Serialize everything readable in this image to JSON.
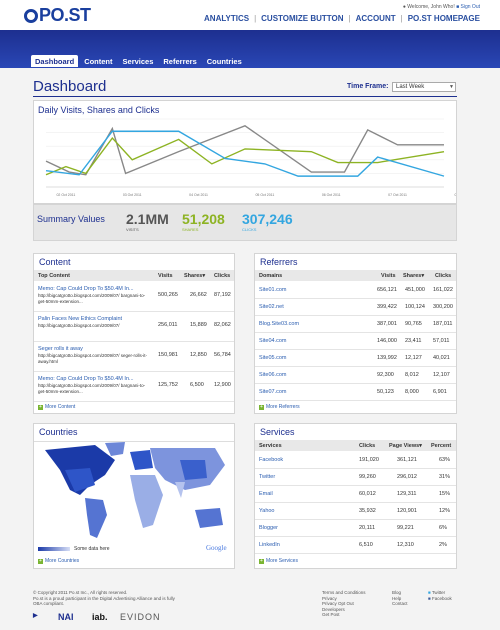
{
  "header": {
    "logo_text": "PO.ST",
    "welcome": "Welcome, John Who!",
    "signout": "Sign Out",
    "nav": [
      "ANALYTICS",
      "CUSTOMIZE BUTTON",
      "ACCOUNT",
      "PO.ST HOMEPAGE"
    ]
  },
  "tabs": [
    "Dashboard",
    "Content",
    "Services",
    "Referrers",
    "Countries"
  ],
  "page": {
    "title": "Dashboard",
    "timeframe_label": "Time Frame:",
    "timeframe_value": "Last Week"
  },
  "chart_data": {
    "type": "line",
    "title": "Daily Visits, Shares and Clicks",
    "x": [
      "02 Oct 2011",
      "03 Oct 2011",
      "04 Oct 2011",
      "05 Oct 2011",
      "06 Oct 2011",
      "07 Oct 2011",
      "08 Oct 2011"
    ],
    "yticks": [
      "",
      "",
      "",
      "",
      ""
    ],
    "ylim": [
      0,
      5
    ],
    "series": [
      {
        "color": "#888888",
        "points": [
          [
            0,
            1.9
          ],
          [
            0.35,
            1.1
          ],
          [
            0.6,
            0.9
          ],
          [
            1.0,
            4.3
          ],
          [
            1.2,
            1.0
          ],
          [
            2.0,
            2.6
          ],
          [
            3.0,
            4.5
          ],
          [
            4.0,
            1.1
          ],
          [
            4.5,
            1.1
          ],
          [
            4.85,
            4.2
          ],
          [
            5.3,
            3.1
          ],
          [
            6.0,
            3.1
          ]
        ]
      },
      {
        "color": "#8db323",
        "points": [
          [
            0,
            0.9
          ],
          [
            0.3,
            1.5
          ],
          [
            0.6,
            1.0
          ],
          [
            1.0,
            3.6
          ],
          [
            1.3,
            2.0
          ],
          [
            2.0,
            3.5
          ],
          [
            2.5,
            1.7
          ],
          [
            3.0,
            2.8
          ],
          [
            4.0,
            2.6
          ],
          [
            4.4,
            1.8
          ],
          [
            5.0,
            1.8
          ],
          [
            6.0,
            2.6
          ]
        ]
      },
      {
        "color": "#33a6e0",
        "points": [
          [
            0,
            1.2
          ],
          [
            0.5,
            0.9
          ],
          [
            1.0,
            4.1
          ],
          [
            2.0,
            4.1
          ],
          [
            2.7,
            2.1
          ],
          [
            3.3,
            1.7
          ],
          [
            3.8,
            0.8
          ],
          [
            4.7,
            0.8
          ],
          [
            5.0,
            2.2
          ],
          [
            6.0,
            0.8
          ]
        ]
      }
    ]
  },
  "summary": {
    "label": "Summary Values",
    "visits_value": "2.1MM",
    "visits_label": "VISITS",
    "shares_value": "51,208",
    "shares_label": "SHARES",
    "clicks_value": "307,246",
    "clicks_label": "CLICKS",
    "visits_color": "#555555",
    "shares_color": "#8db323",
    "clicks_color": "#33a6e0"
  },
  "content": {
    "title": "Content",
    "headers": [
      "Top Content",
      "Visits",
      "Shares",
      "Clicks"
    ],
    "rows": [
      {
        "title": "Memo: Cap Could Drop To $50.4M In...",
        "url": "http://bigcatgrotto.blogspot.com/2009/07/ bargnani-to-get-50mm-extension...",
        "visits": "500,265",
        "shares": "26,662",
        "clicks": "87,192"
      },
      {
        "title": "Palin Faces New Ethics Complaint",
        "url": "http://bigcatgrotto.blogspot.com/2009/07/",
        "visits": "256,011",
        "shares": "15,889",
        "clicks": "82,062"
      },
      {
        "title": "Seger rolls it away",
        "url": "http://bigcatgrotto.blogspot.com/2009/07/ seger-rolls-it-away.html",
        "visits": "150,981",
        "shares": "12,850",
        "clicks": "56,784"
      },
      {
        "title": "Memo: Cap Could Drop To $50.4M In...",
        "url": "http://bigcatgrotto.blogspot.com/2009/07/ bargnani-to-get-50mm-extension...",
        "visits": "125,752",
        "shares": "6,500",
        "clicks": "12,900"
      }
    ],
    "more": "More Content"
  },
  "referrers": {
    "title": "Referrers",
    "headers": [
      "Domains",
      "Visits",
      "Shares",
      "Clicks"
    ],
    "rows": [
      {
        "domain": "Site01.com",
        "visits": "656,121",
        "shares": "451,000",
        "clicks": "161,022"
      },
      {
        "domain": "Site02.net",
        "visits": "399,422",
        "shares": "100,124",
        "clicks": "300,200"
      },
      {
        "domain": "Blog.Site03.com",
        "visits": "387,001",
        "shares": "90,765",
        "clicks": "187,011"
      },
      {
        "domain": "Site04.com",
        "visits": "146,000",
        "shares": "23,411",
        "clicks": "57,011"
      },
      {
        "domain": "Site05.com",
        "visits": "139,992",
        "shares": "12,127",
        "clicks": "40,021"
      },
      {
        "domain": "Site06.com",
        "visits": "92,300",
        "shares": "8,012",
        "clicks": "12,107"
      },
      {
        "domain": "Site07.com",
        "visits": "50,123",
        "shares": "8,000",
        "clicks": "6,901"
      }
    ],
    "more": "More Referrers"
  },
  "countries": {
    "title": "Countries",
    "legend": "Some data here",
    "google": "Google",
    "more": "More Countries"
  },
  "services": {
    "title": "Services",
    "headers": [
      "Services",
      "Clicks",
      "Page Views",
      "Percent"
    ],
    "rows": [
      {
        "service": "Facebook",
        "clicks": "191,020",
        "views": "361,121",
        "percent": "63%"
      },
      {
        "service": "Twitter",
        "clicks": "99,260",
        "views": "296,012",
        "percent": "31%"
      },
      {
        "service": "Email",
        "clicks": "60,012",
        "views": "129,311",
        "percent": "15%"
      },
      {
        "service": "Yahoo",
        "clicks": "35,932",
        "views": "120,901",
        "percent": "12%"
      },
      {
        "service": "Blogger",
        "clicks": "20,111",
        "views": "99,221",
        "percent": "6%"
      },
      {
        "service": "LinkedIn",
        "clicks": "6,510",
        "views": "12,310",
        "percent": "2%"
      }
    ],
    "more": "More Services"
  },
  "footer": {
    "copyright": "© Copyright 2011 Po.st Inc., All rights reserved.",
    "participant": "Po.st is a proud participant in the Digital Advertising Alliance and is fully OBA compliant.",
    "links1": [
      "Terms and Conditions",
      "Privacy",
      "Privacy Opt Out",
      "Developers",
      "Get Post"
    ],
    "links2": [
      "Blog",
      "Help",
      "Contact"
    ],
    "social": [
      "Twitter",
      "Facebook"
    ],
    "logos": [
      "NAI",
      "iab.",
      "EVIDON"
    ]
  }
}
